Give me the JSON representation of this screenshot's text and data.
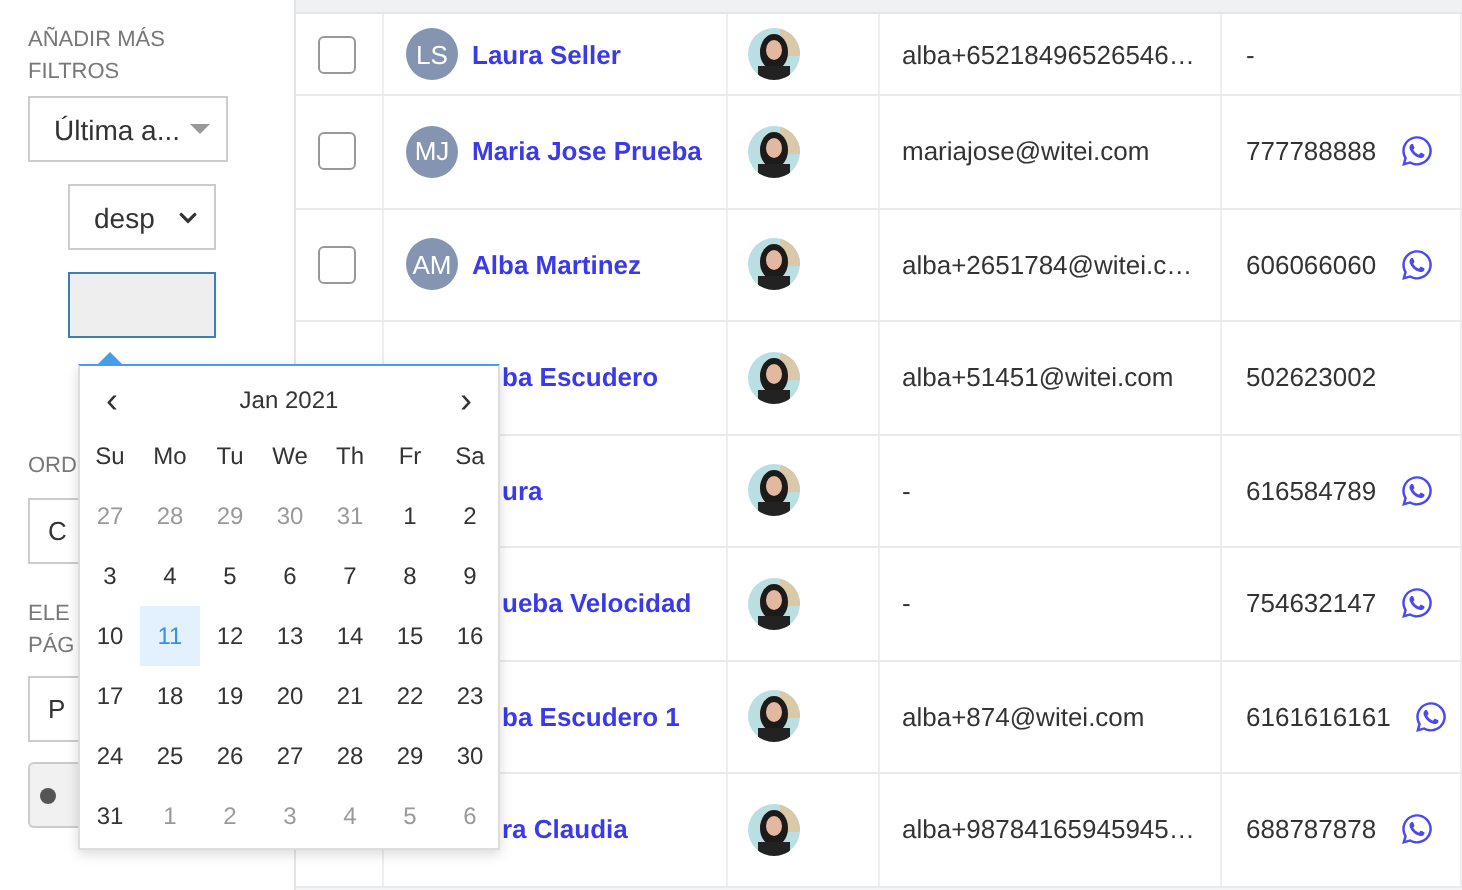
{
  "sidebar": {
    "section_label": "AÑADIR MÁS FILTROS",
    "filter_select": "Última a...",
    "operator_select": "desp",
    "order_label": "ORD",
    "order_select": "C",
    "per_page_label": [
      "ELE",
      "PÁG"
    ],
    "per_page_select": "P"
  },
  "datepicker": {
    "prev": "‹",
    "title": "Jan 2021",
    "next": "›",
    "weekdays": [
      "Su",
      "Mo",
      "Tu",
      "We",
      "Th",
      "Fr",
      "Sa"
    ],
    "weeks": [
      [
        {
          "day": "27",
          "muted": true,
          "selected": false
        },
        {
          "day": "28",
          "muted": true,
          "selected": false
        },
        {
          "day": "29",
          "muted": true,
          "selected": false
        },
        {
          "day": "30",
          "muted": true,
          "selected": false
        },
        {
          "day": "31",
          "muted": true,
          "selected": false
        },
        {
          "day": "1",
          "muted": false,
          "selected": false
        },
        {
          "day": "2",
          "muted": false,
          "selected": false
        }
      ],
      [
        {
          "day": "3",
          "muted": false,
          "selected": false
        },
        {
          "day": "4",
          "muted": false,
          "selected": false
        },
        {
          "day": "5",
          "muted": false,
          "selected": false
        },
        {
          "day": "6",
          "muted": false,
          "selected": false
        },
        {
          "day": "7",
          "muted": false,
          "selected": false
        },
        {
          "day": "8",
          "muted": false,
          "selected": false
        },
        {
          "day": "9",
          "muted": false,
          "selected": false
        }
      ],
      [
        {
          "day": "10",
          "muted": false,
          "selected": false
        },
        {
          "day": "11",
          "muted": false,
          "selected": true
        },
        {
          "day": "12",
          "muted": false,
          "selected": false
        },
        {
          "day": "13",
          "muted": false,
          "selected": false
        },
        {
          "day": "14",
          "muted": false,
          "selected": false
        },
        {
          "day": "15",
          "muted": false,
          "selected": false
        },
        {
          "day": "16",
          "muted": false,
          "selected": false
        }
      ],
      [
        {
          "day": "17",
          "muted": false,
          "selected": false
        },
        {
          "day": "18",
          "muted": false,
          "selected": false
        },
        {
          "day": "19",
          "muted": false,
          "selected": false
        },
        {
          "day": "20",
          "muted": false,
          "selected": false
        },
        {
          "day": "21",
          "muted": false,
          "selected": false
        },
        {
          "day": "22",
          "muted": false,
          "selected": false
        },
        {
          "day": "23",
          "muted": false,
          "selected": false
        }
      ],
      [
        {
          "day": "24",
          "muted": false,
          "selected": false
        },
        {
          "day": "25",
          "muted": false,
          "selected": false
        },
        {
          "day": "26",
          "muted": false,
          "selected": false
        },
        {
          "day": "27",
          "muted": false,
          "selected": false
        },
        {
          "day": "28",
          "muted": false,
          "selected": false
        },
        {
          "day": "29",
          "muted": false,
          "selected": false
        },
        {
          "day": "30",
          "muted": false,
          "selected": false
        }
      ],
      [
        {
          "day": "31",
          "muted": false,
          "selected": false
        },
        {
          "day": "1",
          "muted": true,
          "selected": false
        },
        {
          "day": "2",
          "muted": true,
          "selected": false
        },
        {
          "day": "3",
          "muted": true,
          "selected": false
        },
        {
          "day": "4",
          "muted": true,
          "selected": false
        },
        {
          "day": "5",
          "muted": true,
          "selected": false
        },
        {
          "day": "6",
          "muted": true,
          "selected": false
        }
      ]
    ]
  },
  "table": {
    "rows": [
      {
        "checked": false,
        "initials": "LS",
        "name": "Laura Seller",
        "email": "alba+65218496526546…",
        "phone": "-",
        "whatsapp": false
      },
      {
        "checked": false,
        "initials": "MJ",
        "name": "Maria Jose Prueba",
        "email": "mariajose@witei.com",
        "phone": "777788888",
        "whatsapp": true
      },
      {
        "checked": false,
        "initials": "AM",
        "name": "Alba Martinez",
        "email": "alba+2651784@witei.c…",
        "phone": "606066060",
        "whatsapp": true
      },
      {
        "name": "ba Escudero",
        "email": "alba+51451@witei.com",
        "phone": "502623002",
        "whatsapp": false
      },
      {
        "name": "ura",
        "email": "-",
        "phone": "616584789",
        "whatsapp": true
      },
      {
        "name": "ueba Velocidad",
        "email": "-",
        "phone": "754632147",
        "whatsapp": true
      },
      {
        "name": "ba Escudero 1",
        "email": "alba+874@witei.com",
        "phone": "6161616161",
        "whatsapp": true
      },
      {
        "name": "ra Claudia",
        "email": "alba+98784165945945…",
        "phone": "688787878",
        "whatsapp": true
      }
    ]
  }
}
